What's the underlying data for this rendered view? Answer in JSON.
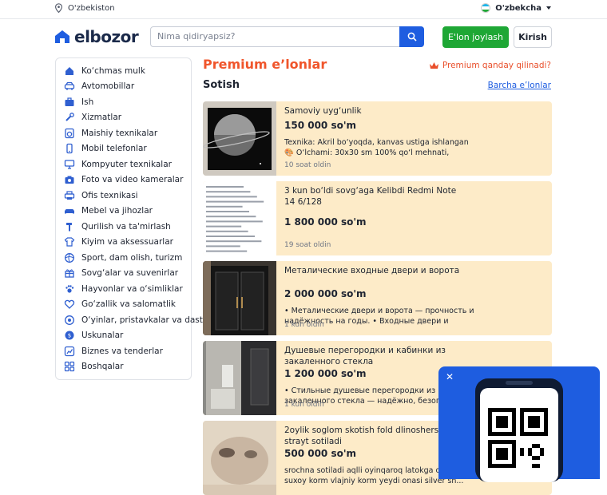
{
  "topbar": {
    "location": "O'zbekiston",
    "language": "O'zbekcha"
  },
  "header": {
    "logo": "elbozor",
    "search_placeholder": "Nima qidiryapsiz?",
    "post_button": "E'lon joylash",
    "login_button": "Kirish"
  },
  "sidebar": {
    "items": [
      {
        "label": "Ko‘chmas mulk",
        "icon": "house-icon"
      },
      {
        "label": "Avtomobillar",
        "icon": "car-icon"
      },
      {
        "label": "Ish",
        "icon": "briefcase-icon"
      },
      {
        "label": "Xizmatlar",
        "icon": "tools-icon"
      },
      {
        "label": "Maishiy texnikalar",
        "icon": "washer-icon"
      },
      {
        "label": "Mobil telefonlar",
        "icon": "phone-icon"
      },
      {
        "label": "Kompyuter texnikalar",
        "icon": "computer-icon"
      },
      {
        "label": "Foto va video kameralar",
        "icon": "camera-icon"
      },
      {
        "label": "Ofis texnikasi",
        "icon": "printer-icon"
      },
      {
        "label": "Mebel va jihozlar",
        "icon": "sofa-icon"
      },
      {
        "label": "Qurilish va ta'mirlash",
        "icon": "hammer-icon"
      },
      {
        "label": "Kiyim va aksessuarlar",
        "icon": "shirt-icon"
      },
      {
        "label": "Sport, dam olish, turizm",
        "icon": "ball-icon"
      },
      {
        "label": "Sovg‘alar va suvenirlar",
        "icon": "gift-icon"
      },
      {
        "label": "Hayvonlar va o‘simliklar",
        "icon": "paw-icon"
      },
      {
        "label": "Go‘zallik va salomatlik",
        "icon": "heart-icon"
      },
      {
        "label": "O‘yinlar, pristavkalar va dasturlar",
        "icon": "gamepad-icon"
      },
      {
        "label": "Uskunalar",
        "icon": "gear-icon"
      },
      {
        "label": "Biznes va tenderlar",
        "icon": "chart-icon"
      },
      {
        "label": "Boshqalar",
        "icon": "grid-icon"
      }
    ]
  },
  "main": {
    "title": "Premium e’lonlar",
    "premium_link": "Premium qanday qilinadi?",
    "section_title": "Sotish",
    "all_link": "Barcha e’lonlar",
    "listings": [
      {
        "title": "Samoviy uyg‘unlik",
        "price": "150 000 so'm",
        "description": "Texnika: Akril bo‘yoqda, kanvas ustiga ishlangan 🎨 O‘lchami: 30x30 sm 100% qo‘l mehnati, yagona nus...",
        "time": "10 soat oldin",
        "thumb": "planet-painting"
      },
      {
        "title": "3 kun bo‘ldi sovg‘aga Kelibdi Redmi Note 14 6/128",
        "price": "1 800 000 so'm",
        "description": "",
        "time": "19 soat oldin",
        "thumb": "spec-sheet"
      },
      {
        "title": "Металические входные двери и ворота",
        "price": "2 000 000 so'm",
        "description": "• Металические двери и ворота — прочность и надёжность на годы. • Входные двери и ворота...",
        "time": "1 kun oldin",
        "thumb": "door"
      },
      {
        "title": "Душевые перегородки и кабинки из закаленного стекла",
        "price": "1 200 000 so'm",
        "description": "• Стильные душевые перегородки из закаленного стекла — надёжно, безопасно, красиво. •...",
        "time": "1 kun oldin",
        "thumb": "shower"
      },
      {
        "title": "2oylik soglom skotish fold dlinosherstviy strayt sotiladi",
        "price": "500 000 so'm",
        "description": "srochna sotiladi aqlli oyinqaroq latokga organgan suxoy korm vlajniy korm yeydi onasi silver sh...",
        "time": "",
        "thumb": "kitten"
      }
    ]
  },
  "colors": {
    "accent": "#1e5de0",
    "premium": "#f0552b",
    "green": "#1ea735",
    "card_bg": "#fdebc8"
  }
}
